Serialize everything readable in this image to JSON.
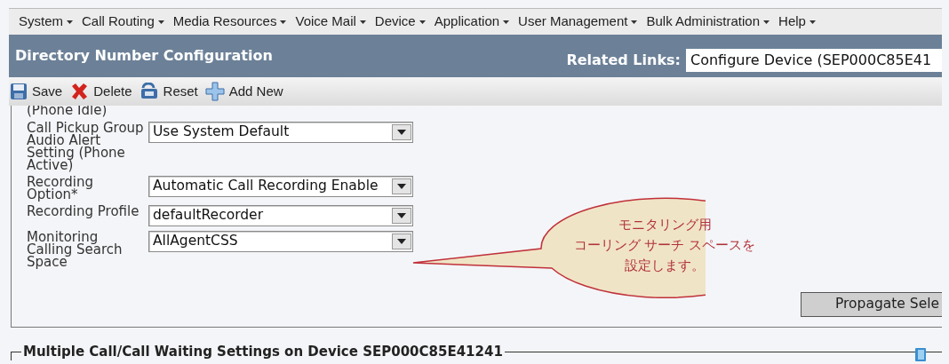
{
  "menu": [
    {
      "label": "System"
    },
    {
      "label": "Call Routing"
    },
    {
      "label": "Media Resources"
    },
    {
      "label": "Voice Mail"
    },
    {
      "label": "Device"
    },
    {
      "label": "Application"
    },
    {
      "label": "User Management"
    },
    {
      "label": "Bulk Administration"
    },
    {
      "label": "Help"
    }
  ],
  "header": {
    "title": "Directory Number Configuration",
    "related_links_label": "Related Links:",
    "related_links_value": "Configure Device (SEP000C85E41"
  },
  "toolbar": [
    {
      "kind": "save",
      "label": "Save"
    },
    {
      "kind": "delete",
      "label": "Delete"
    },
    {
      "kind": "reset",
      "label": "Reset"
    },
    {
      "kind": "add",
      "label": "Add New"
    }
  ],
  "fields": [
    {
      "label": "(Phone Idle)"
    },
    {
      "label": "Call Pickup Group Audio Alert Setting (Phone Active)",
      "value": "Use System Default"
    },
    {
      "label": "Recording Option*",
      "value": "Automatic Call Recording Enable"
    },
    {
      "label": "Recording Profile",
      "value": "defaultRecorder"
    },
    {
      "label": "Monitoring Calling Search Space",
      "value": "AllAgentCSS"
    }
  ],
  "callout": {
    "lines": [
      "モニタリング用",
      "コーリング サーチ スペースを",
      "設定します。"
    ]
  },
  "propagate_button": "Propagate Sele",
  "section_legend": "Multiple Call/Call Waiting Settings on Device SEP000C85E41241"
}
